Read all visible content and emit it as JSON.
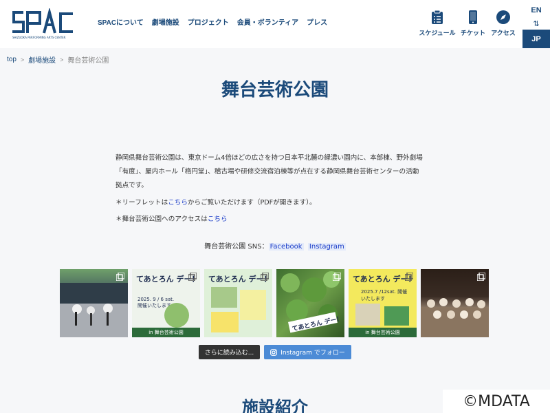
{
  "header": {
    "logo_text": "SPAC",
    "nav": [
      "SPACについて",
      "劇場施設",
      "プロジェクト",
      "会員・ボランティア",
      "プレス"
    ],
    "utils": [
      {
        "label": "スケジュール",
        "icon": "schedule-icon"
      },
      {
        "label": "チケット",
        "icon": "ticket-phone-icon"
      },
      {
        "label": "アクセス",
        "icon": "compass-icon"
      }
    ],
    "lang": {
      "en": "EN",
      "switch": "⇅",
      "jp": "JP"
    }
  },
  "breadcrumb": {
    "top": "top",
    "sep": ">",
    "parent": "劇場施設",
    "current": "舞台芸術公園"
  },
  "page_title": "舞台芸術公園",
  "body": {
    "lines": [
      "静岡県舞台芸術公園は、東京ドーム4倍ほどの広さを持つ日本平北麓の緑濃い園内に、本部棟、野外劇場",
      "「有度」、屋内ホール「楕円堂」、稽古場や研修交流宿泊棟等が点在する静岡県舞台芸術センターの活動",
      "拠点です。"
    ],
    "leaflet_pre": "＊リーフレットは",
    "leaflet_link": "こちら",
    "leaflet_post": "からご覧いただけます（PDFが開きます）。",
    "access_pre": "＊舞台芸術公園へのアクセスは",
    "access_link": "こちら"
  },
  "sns": {
    "label": "舞台芸術公園 SNS：",
    "facebook": "Facebook",
    "instagram": "Instagram"
  },
  "tiles": [
    {
      "id": "t1",
      "kind": "photo"
    },
    {
      "id": "t2",
      "kind": "poster",
      "top": "てあとろん デー！",
      "date": "2025. 9 / 6 sat. 開催いたします",
      "band": "in 舞台芸術公園"
    },
    {
      "id": "t3",
      "kind": "poster",
      "top": "てあとろん デー！",
      "date": "",
      "band": ""
    },
    {
      "id": "t4",
      "kind": "photo",
      "caption": "てあとろん デー！"
    },
    {
      "id": "t5",
      "kind": "poster",
      "top": "てあとろん デー！",
      "date": "2025.7 /12sat. 開催いたします",
      "band": "in 舞台芸術公園"
    },
    {
      "id": "t6",
      "kind": "photo"
    }
  ],
  "buttons": {
    "more": "さらに読み込む...",
    "follow": "Instagram でフォロー"
  },
  "section_title": "施設紹介",
  "watermark": "©MDATA"
}
